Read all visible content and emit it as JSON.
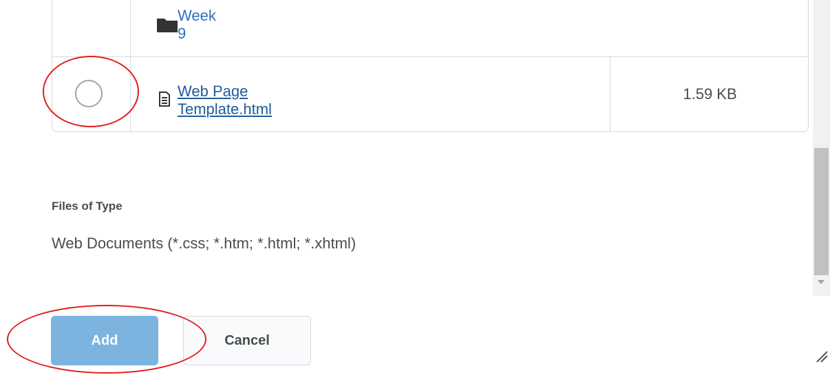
{
  "file_list": {
    "folder": {
      "label": "Week 9",
      "icon": "folder-icon"
    },
    "file": {
      "name": "Web Page Template.html",
      "size": "1.59 KB",
      "icon": "document-icon",
      "selected": false
    }
  },
  "files_of_type": {
    "label": "Files of Type",
    "value": "Web Documents (*.css; *.htm; *.html; *.xhtml)"
  },
  "actions": {
    "add_label": "Add",
    "cancel_label": "Cancel"
  },
  "colors": {
    "link": "#2f6fbf",
    "add_button": "#7cb4df",
    "annotation": "#e31b1b",
    "text": "#494c4e"
  }
}
